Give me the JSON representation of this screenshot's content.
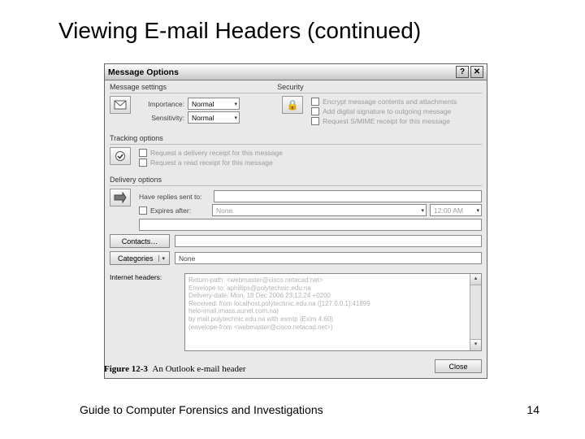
{
  "slide": {
    "title": "Viewing E-mail Headers (continued)",
    "footer": "Guide to Computer Forensics and Investigations",
    "page": "14"
  },
  "figure": {
    "number": "Figure 12-3",
    "caption": "An Outlook e-mail header"
  },
  "dialog": {
    "title": "Message Options",
    "help_btn": "?",
    "close_btn": "✕",
    "sections": {
      "settings": "Message settings",
      "security": "Security",
      "tracking": "Tracking options",
      "delivery": "Delivery options",
      "headers": "Internet headers:"
    },
    "settings": {
      "importance_label": "Importance:",
      "importance_value": "Normal",
      "sensitivity_label": "Sensitivity:",
      "sensitivity_value": "Normal"
    },
    "security": {
      "encrypt": "Encrypt message contents and attachments",
      "sign": "Add digital signature to outgoing message",
      "smime": "Request S/MIME receipt for this message"
    },
    "tracking": {
      "delivery_receipt": "Request a delivery receipt for this message",
      "read_receipt": "Request a read receipt for this message"
    },
    "delivery": {
      "replies_label": "Have replies sent to:",
      "expires_label": "Expires after:",
      "expires_date": "None",
      "expires_time": "12:00 AM",
      "contacts_btn": "Contacts…",
      "categories_btn": "Categories",
      "categories_value": "None"
    },
    "headers_lines": [
      "Return-path: <webmaster@cisco.netacad.net>",
      "Envelope-to: aphillips@polytechnic.edu.na",
      "Delivery-date: Mon, 18 Dec 2006 23:12:24 +0200",
      "Received: from localhost.polytechnic.edu.na ([127.0.0.1]:41899",
      "helo=mail.imass.aunet.com.na)",
      "        by mail.polytechnic.edu.na with esmtp (Exim 4.60)",
      "        (envelope-from <webmaster@cisco.netacad.net>)"
    ],
    "close_label": "Close"
  }
}
